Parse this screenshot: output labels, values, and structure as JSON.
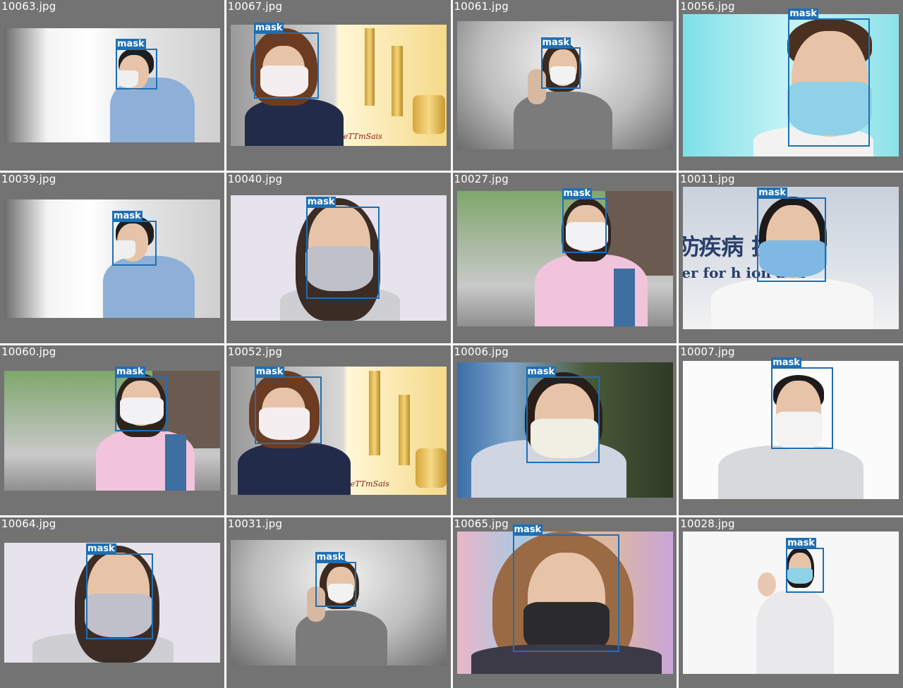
{
  "label_class": "mask",
  "colors": {
    "panel_bg": "#737373",
    "box": "#1f6fb4",
    "filename_text": "#ffffff"
  },
  "tiles": [
    {
      "filename": "10063.jpg",
      "detections": [
        {
          "label": "mask"
        }
      ]
    },
    {
      "filename": "10067.jpg",
      "detections": [
        {
          "label": "mask"
        }
      ],
      "watermark": "eTTmSais"
    },
    {
      "filename": "10061.jpg",
      "detections": [
        {
          "label": "mask"
        }
      ]
    },
    {
      "filename": "10056.jpg",
      "detections": [
        {
          "label": "mask"
        }
      ]
    },
    {
      "filename": "10039.jpg",
      "detections": [
        {
          "label": "mask"
        }
      ]
    },
    {
      "filename": "10040.jpg",
      "detections": [
        {
          "label": "mask"
        }
      ]
    },
    {
      "filename": "10027.jpg",
      "detections": [
        {
          "label": "mask"
        }
      ]
    },
    {
      "filename": "10011.jpg",
      "detections": [
        {
          "label": "mask"
        }
      ],
      "sign_cn": "疾病   控制",
      "sign_cn_left": "防",
      "sign_en": "er for h          ion and"
    },
    {
      "filename": "10060.jpg",
      "detections": [
        {
          "label": "mask"
        }
      ]
    },
    {
      "filename": "10052.jpg",
      "detections": [
        {
          "label": "mask"
        }
      ],
      "watermark": "eTTmSais"
    },
    {
      "filename": "10006.jpg",
      "detections": [
        {
          "label": "mask"
        }
      ]
    },
    {
      "filename": "10007.jpg",
      "detections": [
        {
          "label": "mask"
        }
      ]
    },
    {
      "filename": "10064.jpg",
      "detections": [
        {
          "label": "mask"
        }
      ]
    },
    {
      "filename": "10031.jpg",
      "detections": [
        {
          "label": "mask"
        }
      ]
    },
    {
      "filename": "10065.jpg",
      "detections": [
        {
          "label": "mask"
        }
      ]
    },
    {
      "filename": "10028.jpg",
      "detections": [
        {
          "label": "mask"
        }
      ]
    }
  ]
}
